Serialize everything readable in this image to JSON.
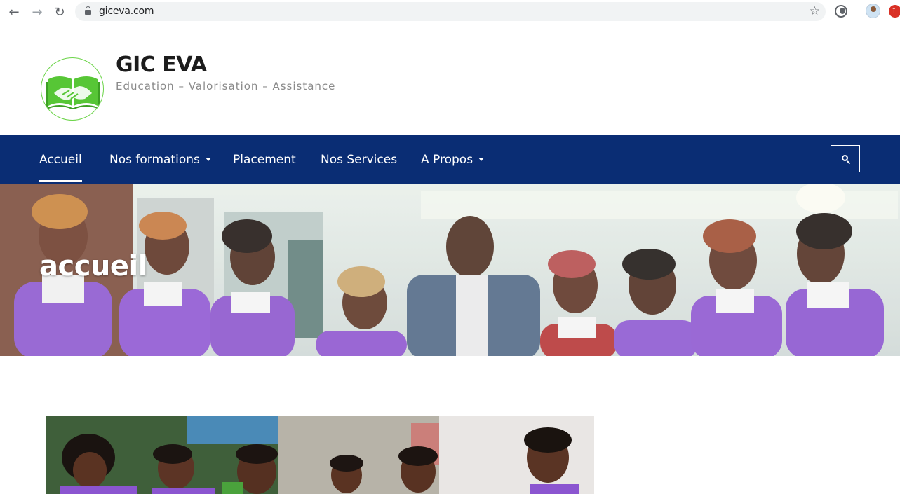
{
  "browser": {
    "url": "giceva.com",
    "icons": [
      "back-icon",
      "forward-icon",
      "reload-icon",
      "lock-icon",
      "star-icon",
      "dark-mode-extension-icon",
      "profile-avatar",
      "extension-red-icon"
    ]
  },
  "site": {
    "title": "GIC EVA",
    "tagline": "Education – Valorisation – Assistance"
  },
  "nav": {
    "items": [
      {
        "label": "Accueil",
        "active": true,
        "dropdown": false
      },
      {
        "label": "Nos formations",
        "active": false,
        "dropdown": true
      },
      {
        "label": "Placement",
        "active": false,
        "dropdown": false
      },
      {
        "label": "Nos Services",
        "active": false,
        "dropdown": false
      },
      {
        "label": "A Propos",
        "active": false,
        "dropdown": true
      }
    ],
    "search_icon": "search-icon"
  },
  "hero": {
    "title": "accueil",
    "image": "group-photo-staff-purple-uniforms"
  },
  "content": {
    "image": "group-photo-students-outdoors"
  },
  "colors": {
    "nav_bg": "#0a2d74",
    "logo_green": "#5cc93a",
    "uniform_purple": "#8a4fcf"
  }
}
